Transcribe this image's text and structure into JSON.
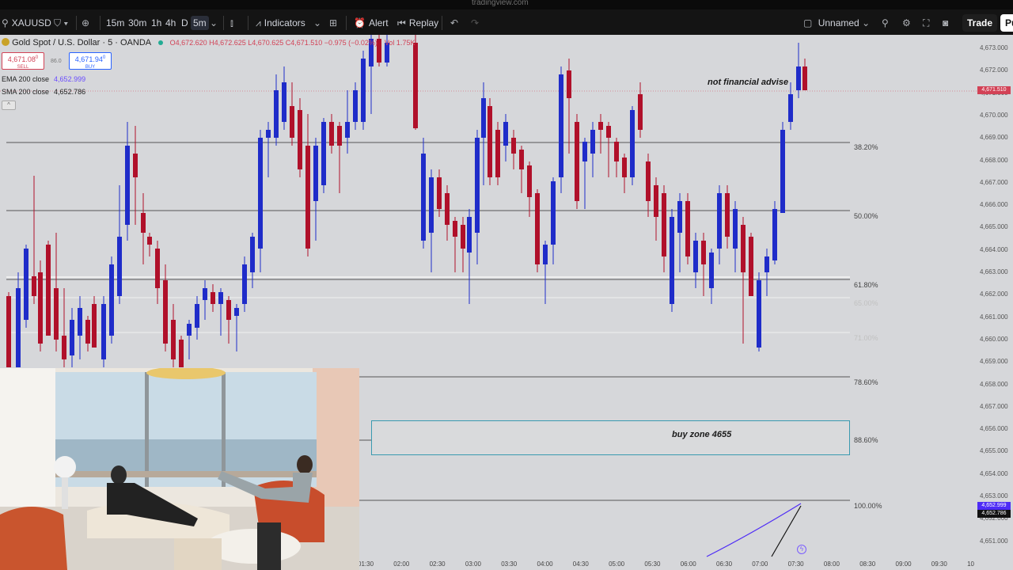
{
  "browser": {
    "url": "tradingview.com"
  },
  "toolbar": {
    "symbol": "XAUUSD",
    "intervals": [
      "15m",
      "30m",
      "1h",
      "4h",
      "D"
    ],
    "active_interval": "5m",
    "indicators_label": "Indicators",
    "alert_label": "Alert",
    "replay_label": "Replay",
    "layout_name": "Unnamed",
    "trade_label": "Trade",
    "publish_label": "Pu"
  },
  "legend": {
    "title": "Gold Spot / U.S. Dollar · 5 · OANDA",
    "ohlc": "O4,672.620 H4,672.625 L4,670.625 C4,671.510 −0.975 (−0.02%)",
    "volume": "Vol 1.75K",
    "sell_price": "4,671.08",
    "sell_sup": "0",
    "sell_label": "SELL",
    "spread": "86.0",
    "buy_price": "4,671.94",
    "buy_sup": "0",
    "buy_label": "BUY",
    "ema_label": "EMA 200 close",
    "ema_value": "4,652.999",
    "sma_label": "SMA 200 close",
    "sma_value": "4,652.786",
    "collapse_glyph": "^"
  },
  "annotations": {
    "disclaimer": "not financial advise",
    "buy_zone": "buy zone 4655"
  },
  "fib_levels": [
    {
      "label": "38.20%",
      "faint": false
    },
    {
      "label": "50.00%",
      "faint": false
    },
    {
      "label": "61.80%",
      "faint": false
    },
    {
      "label": "65.00%",
      "faint": true
    },
    {
      "label": "71.00%",
      "faint": true
    },
    {
      "label": "78.60%",
      "faint": false
    },
    {
      "label": "88.60%",
      "faint": false
    },
    {
      "label": "100.00%",
      "faint": false
    }
  ],
  "price_scale": [
    "4,673.000",
    "4,672.000",
    "4,671.000",
    "4,670.000",
    "4,669.000",
    "4,668.000",
    "4,667.000",
    "4,666.000",
    "4,665.000",
    "4,664.000",
    "4,663.000",
    "4,662.000",
    "4,661.000",
    "4,660.000",
    "4,659.000",
    "4,658.000",
    "4,657.000",
    "4,656.000",
    "4,655.000",
    "4,654.000",
    "4,653.000",
    "4,652.000",
    "4,651.000"
  ],
  "current_price_tag": "4,671.510",
  "ema_tag": "4,652.999",
  "sma_tag": "4,652.786",
  "time_axis": [
    "01:30",
    "02:00",
    "02:30",
    "03:00",
    "03:30",
    "04:00",
    "04:30",
    "05:00",
    "05:30",
    "06:00",
    "06:30",
    "07:00",
    "07:30",
    "08:00",
    "08:30",
    "09:00",
    "09:30",
    "10"
  ],
  "colors": {
    "up": "#1f2cc9",
    "down": "#b0102a",
    "bg": "#d6d7da",
    "zone_border": "#3a9ab0"
  },
  "icons": [
    "search-icon",
    "plus-icon",
    "candle-type-icon",
    "indicators-icon",
    "layout-grid-icon",
    "alert-icon",
    "replay-icon",
    "undo-icon",
    "redo-icon",
    "quick-search-icon",
    "settings-icon",
    "fullscreen-icon",
    "camera-icon",
    "lightning-icon"
  ]
}
